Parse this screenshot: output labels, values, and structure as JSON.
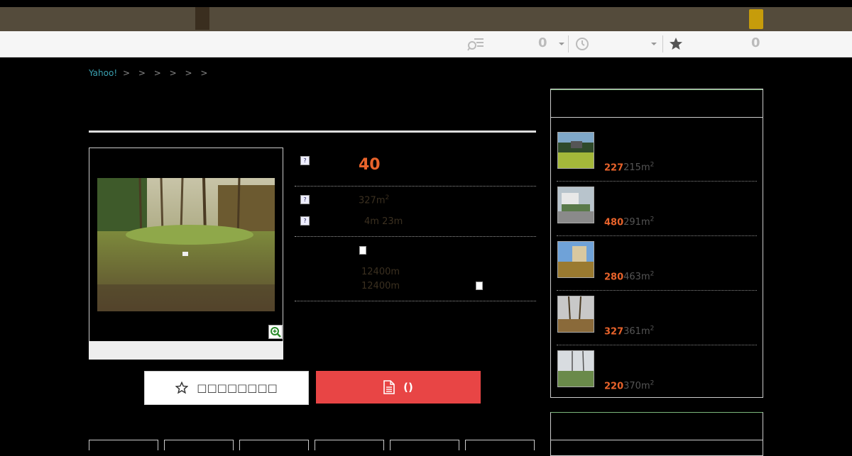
{
  "header": {
    "colors": {
      "bar": "#544b3b",
      "accent_gold": "#c69c0b",
      "accent_dark": "#3a2e1f"
    }
  },
  "toolbar": {
    "search_history_count": "0",
    "recent_count": "",
    "favorites_count": "0",
    "icons": [
      "search-list-icon",
      "dropdown-caret-icon",
      "clock-icon",
      "dropdown-caret-icon",
      "star-icon"
    ]
  },
  "breadcrumb": {
    "home": "Yahoo!",
    "separators": [
      ">",
      ">",
      ">",
      ">",
      ">",
      ">"
    ]
  },
  "listing": {
    "price": "40",
    "area_value": "327m",
    "area_sup": "2",
    "road_frontage": "4m 23m",
    "distance_1": "12400m",
    "distance_2": "12400m",
    "help_icon_glyph": "?",
    "colors": {
      "price": "#e8632b",
      "value_text": "#3b3020"
    }
  },
  "actions": {
    "favorite_label": "",
    "favorite_display": "□□□□□□□□",
    "request_label": "()"
  },
  "sidebar": {
    "items": [
      {
        "price": "227",
        "area": "215m",
        "sup": "2"
      },
      {
        "price": "480",
        "area": "291m",
        "sup": "2"
      },
      {
        "price": "280",
        "area": "463m",
        "sup": "2"
      },
      {
        "price": "327",
        "area": "361m",
        "sup": "2"
      },
      {
        "price": "220",
        "area": "370m",
        "sup": "2"
      }
    ]
  }
}
